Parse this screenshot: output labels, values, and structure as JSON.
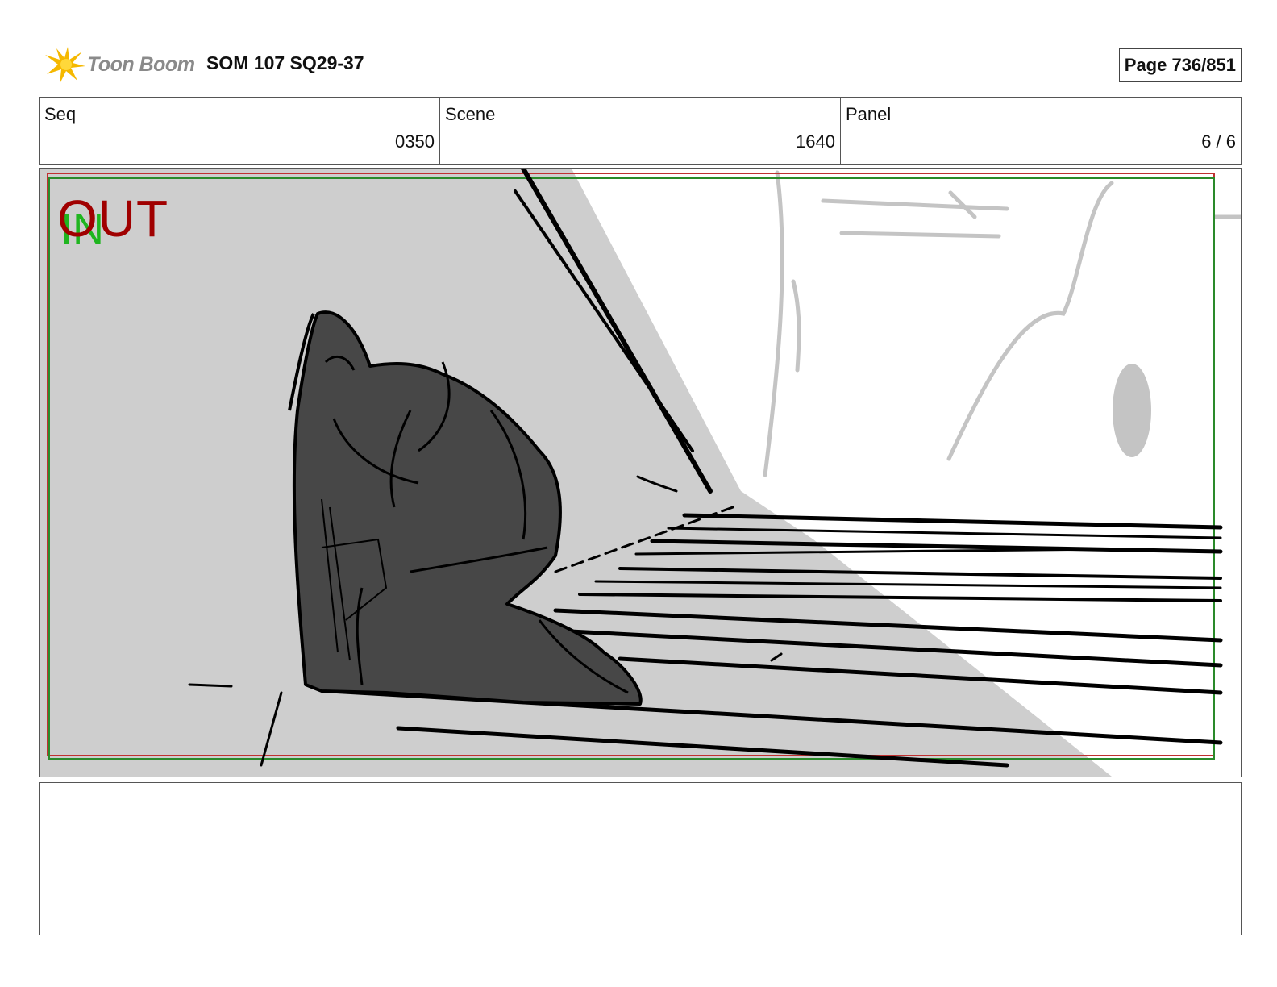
{
  "header": {
    "logo_text": "Toon Boom",
    "title": "SOM 107 SQ29-37",
    "page_label": "Page 736/851"
  },
  "info": {
    "seq": {
      "label": "Seq",
      "value": "0350"
    },
    "scene": {
      "label": "Scene",
      "value": "1640"
    },
    "panel": {
      "label": "Panel",
      "value": "6 / 6"
    }
  },
  "frame": {
    "out_label": "OUT",
    "in_label": "IN",
    "out_color": "#a00000",
    "in_color": "#1fb51f"
  },
  "notes": {
    "text": ""
  }
}
